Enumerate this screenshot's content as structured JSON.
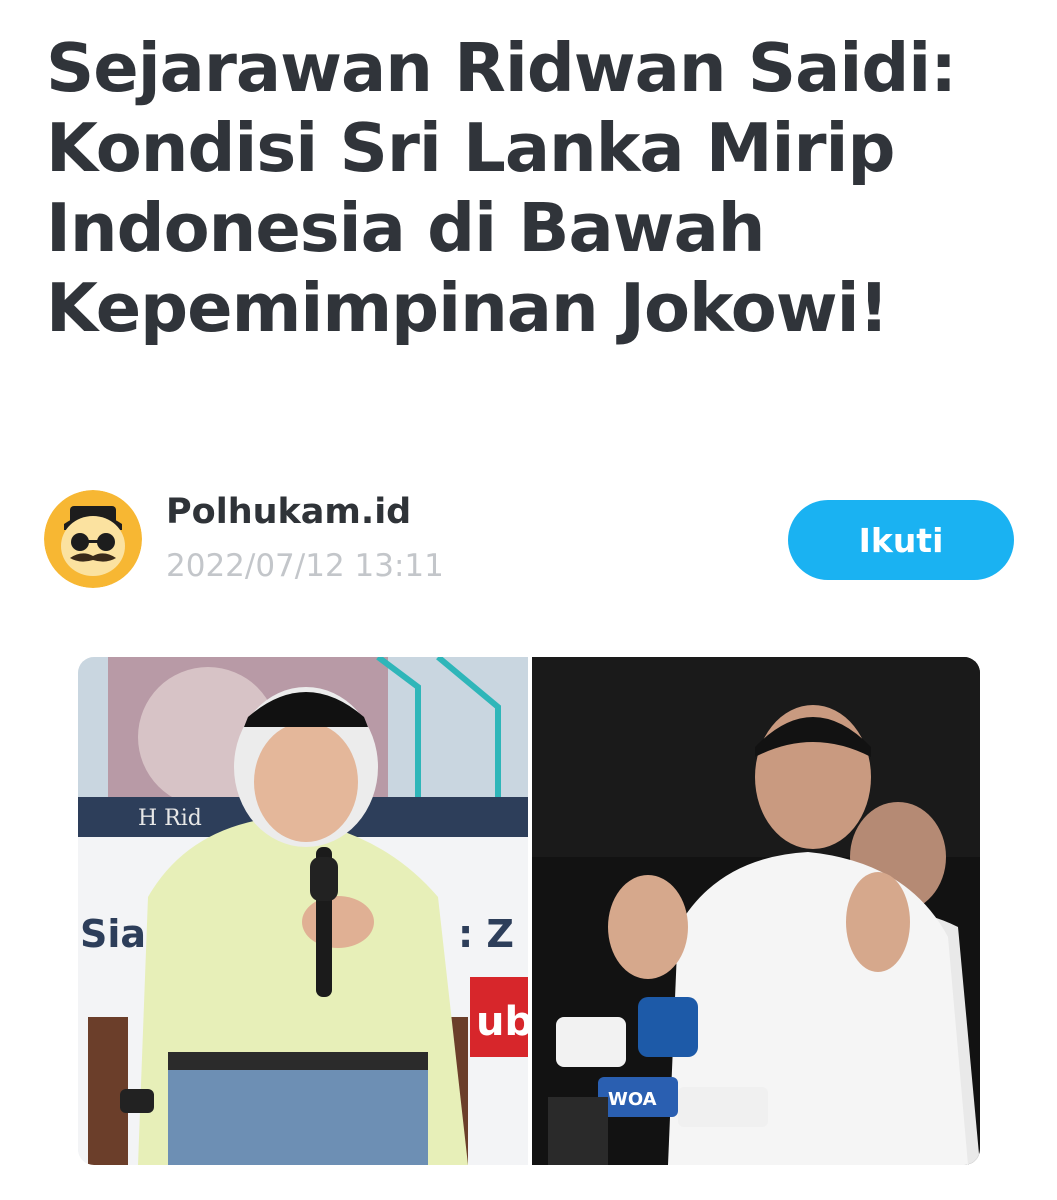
{
  "article": {
    "headline": "Sejarawan Ridwan Saidi: Kondisi Sri Lanka Mirip Indonesia di Bawah Kepemimpinan Jokowi!"
  },
  "author": {
    "name": "Polhukam.id",
    "timestamp": "2022/07/12 13:11",
    "avatar_icon": "mustache-man-avatar-icon"
  },
  "actions": {
    "follow_label": "Ikuti"
  },
  "image": {
    "visible_text": {
      "left_sign_1": "Sia",
      "left_sign_2": ": Z",
      "left_badge": "ub",
      "left_banner": "H Rid",
      "mic_flag": "WOA"
    }
  },
  "colors": {
    "headline": "#30343a",
    "date": "#c3c6ca",
    "follow_button": "#1ab2f2"
  }
}
